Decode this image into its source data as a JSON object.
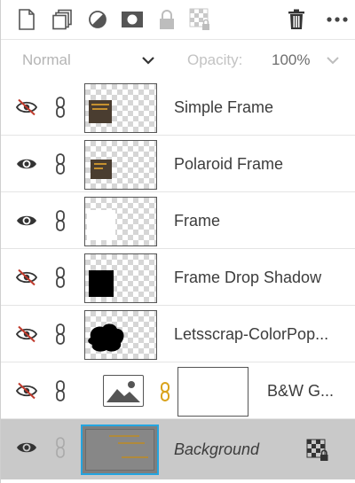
{
  "toolbar": {
    "icons": [
      {
        "name": "new-layer-icon"
      },
      {
        "name": "duplicate-layer-icon"
      },
      {
        "name": "adjustment-layer-icon"
      },
      {
        "name": "layer-mask-icon"
      },
      {
        "name": "lock-all-icon"
      },
      {
        "name": "lock-transparency-icon"
      },
      {
        "name": "delete-layer-icon"
      },
      {
        "name": "more-options-icon"
      }
    ]
  },
  "blend": {
    "mode": "Normal",
    "opacity_label": "Opacity:",
    "opacity_value": "100%"
  },
  "layers": [
    {
      "label": "Simple Frame",
      "visible": false
    },
    {
      "label": "Polaroid Frame",
      "visible": true
    },
    {
      "label": "Frame",
      "visible": true
    },
    {
      "label": "Frame Drop Shadow",
      "visible": false
    },
    {
      "label": "Letsscrap-ColorPop...",
      "visible": false
    },
    {
      "label": "B&W G...",
      "visible": false
    },
    {
      "label": "Background",
      "visible": true,
      "selected": true
    }
  ],
  "colors": {
    "selected_row": "#c9c9c9",
    "selection_border": "#24a4df",
    "hidden_eye_slash": "#c0392b",
    "chain_link_gold": "#d9a21a"
  }
}
